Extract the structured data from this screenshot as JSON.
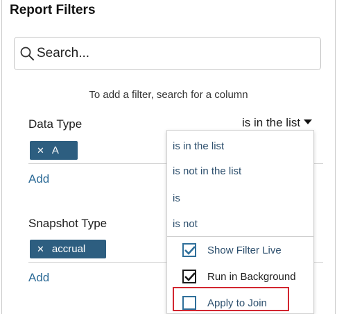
{
  "title": "Report Filters",
  "search": {
    "placeholder": "Search..."
  },
  "hint": "To add a filter, search for a column",
  "filters": [
    {
      "label": "Data Type",
      "operator": "is in the list",
      "chip": "A",
      "add": "Add"
    },
    {
      "label": "Snapshot Type",
      "chip": "accrual",
      "add": "Add"
    }
  ],
  "dropdown": {
    "options": [
      "is in the list",
      "is not in the list",
      "is",
      "is not"
    ],
    "checks": [
      {
        "label": "Show Filter Live",
        "checked": true
      },
      {
        "label": "Run in Background",
        "checked": true
      },
      {
        "label": "Apply to Join",
        "checked": false
      }
    ],
    "highlight_color": "#d22630"
  },
  "colors": {
    "chip": "#2d5e80",
    "link": "#2d6b97",
    "option_text": "#2d4f6d"
  },
  "icons": {
    "search": "search-icon",
    "remove": "close-icon",
    "caret": "caret-down-icon",
    "check": "check-icon"
  }
}
